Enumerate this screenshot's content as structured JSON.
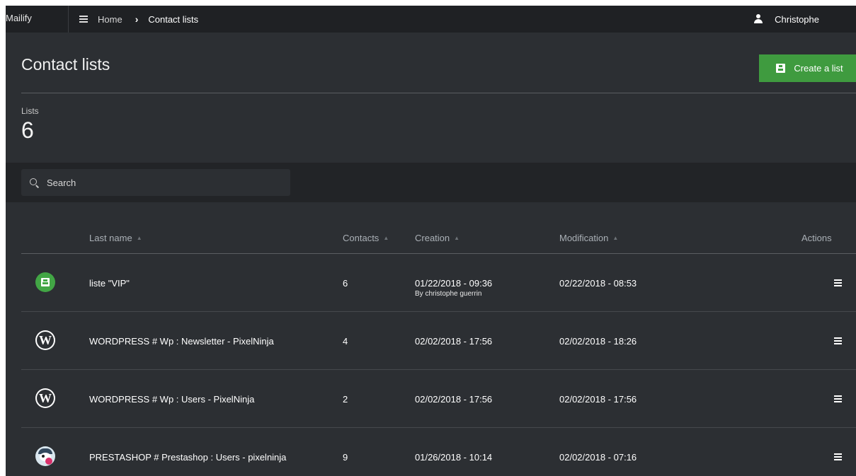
{
  "topbar": {
    "brand": "Mailify",
    "breadcrumb_home": "Home",
    "breadcrumb_separator": "›",
    "breadcrumb_current": "Contact lists",
    "user_name": "Christophe"
  },
  "header": {
    "title": "Contact lists",
    "create_button": "Create a list"
  },
  "stats": {
    "label": "Lists",
    "value": "6"
  },
  "search": {
    "placeholder": "Search"
  },
  "table": {
    "columns": {
      "name": "Last name",
      "contacts": "Contacts",
      "creation": "Creation",
      "modification": "Modification",
      "actions": "Actions"
    },
    "rows": [
      {
        "icon": "contact-card-icon",
        "name": "liste \"VIP\"",
        "contacts": "6",
        "creation": "01/22/2018 - 09:36",
        "created_by": "By christophe guerrin",
        "modification": "02/22/2018 - 08:53"
      },
      {
        "icon": "wordpress-icon",
        "name": "WORDPRESS # Wp : Newsletter - PixelNinja",
        "contacts": "4",
        "creation": "02/02/2018 - 17:56",
        "modification": "02/02/2018 - 18:26"
      },
      {
        "icon": "wordpress-icon",
        "name": "WORDPRESS # Wp : Users - PixelNinja",
        "contacts": "2",
        "creation": "02/02/2018 - 17:56",
        "modification": "02/02/2018 - 17:56"
      },
      {
        "icon": "prestashop-icon",
        "name": "PRESTASHOP # Prestashop : Users - pixelninja",
        "contacts": "9",
        "creation": "01/26/2018 - 10:14",
        "modification": "02/02/2018 - 07:16"
      }
    ]
  },
  "colors": {
    "background": "#2c2f33",
    "topbar": "#1f2124",
    "search_band": "#222427",
    "accent_green": "#3f9b3f"
  }
}
